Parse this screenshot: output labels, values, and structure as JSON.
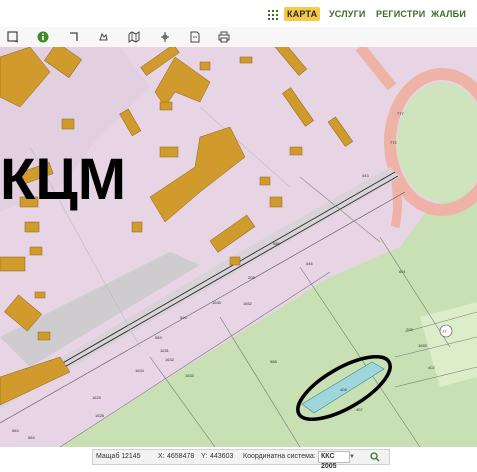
{
  "nav": {
    "items": [
      {
        "label": "КАРТА",
        "active": true
      },
      {
        "label": "УСЛУГИ",
        "active": false
      },
      {
        "label": "РЕГИСТРИ",
        "active": false
      },
      {
        "label": "ЖАЛБИ",
        "active": false
      }
    ]
  },
  "toolbar": {
    "icons": [
      "select-icon",
      "info-icon",
      "measure-icon",
      "pan-icon",
      "map-icon",
      "coordinate-icon",
      "document-icon",
      "print-icon"
    ]
  },
  "map": {
    "area_label": "КЦМ",
    "parcel_numbers": [
      "777",
      "772",
      "443",
      "586",
      "446",
      "601",
      "1653",
      "205",
      "208",
      "1652",
      "588",
      "590",
      "589",
      "1630",
      "1631",
      "1632",
      "1633",
      "1634",
      "1629",
      "1628",
      "584",
      "583",
      "408",
      "407",
      "402",
      "77"
    ]
  },
  "status": {
    "scale_label": "Мащаб 1:",
    "scale_value": "2145",
    "x_label": "X:",
    "x_value": "4658478",
    "y_label": "Y:",
    "y_value": "443603",
    "crs_label": "Координатна система:",
    "crs_value": "ККС 2005"
  },
  "colors": {
    "urban": "#e7d5e5",
    "building": "#d09b2c",
    "green": "#c8e0b4",
    "green_light": "#dcedc9",
    "road_ring": "#efb2a6",
    "highlight": "#9fd6dc",
    "accent_nav": "#f7c948",
    "nav_text": "#3f6b2a"
  }
}
